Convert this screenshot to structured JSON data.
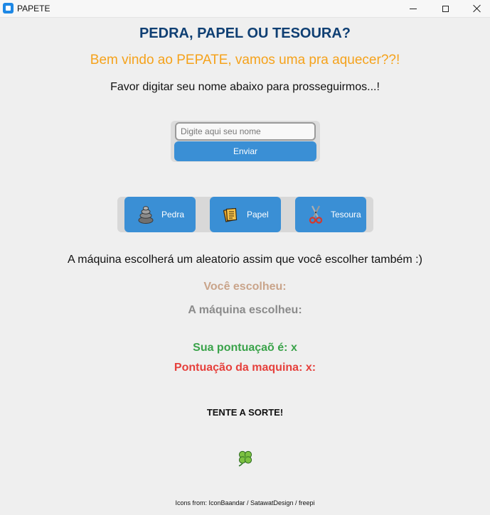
{
  "window": {
    "title": "PAPETE"
  },
  "header": {
    "title": "PEDRA, PAPEL OU TESOURA?",
    "welcome": "Bem vindo ao PEPATE, vamos uma pra aquecer??!",
    "instruction": "Favor digitar seu nome abaixo para prosseguirmos...!"
  },
  "name_form": {
    "placeholder": "Digite aqui seu nome",
    "value": "",
    "submit_label": "Enviar"
  },
  "choices": [
    {
      "label": "Pedra",
      "icon": "stones-icon"
    },
    {
      "label": "Papel",
      "icon": "paper-stack-icon"
    },
    {
      "label": "Tesoura",
      "icon": "scissors-icon"
    }
  ],
  "results": {
    "info": "A máquina escolherá um aleatorio assim que você escolher também :)",
    "you_chose": "Você escolheu:",
    "machine_chose": "A máquina escolheu:",
    "your_score": "Sua pontuaçaõ é: x",
    "machine_score": "Pontuação da maquina: x:"
  },
  "footer": {
    "luck": "TENTE A SORTE!",
    "clover_icon": "four-leaf-clover-icon",
    "credits": "Icons from: IconBaandar / SatawatDesign / freepi"
  },
  "colors": {
    "title": "#0f3f73",
    "welcome": "#f5a21b",
    "button": "#3a8fd5",
    "you_chose": "#c9a48a",
    "machine_chose": "#8b8b8b",
    "your_score": "#3aa34a",
    "machine_score": "#e6403c"
  }
}
